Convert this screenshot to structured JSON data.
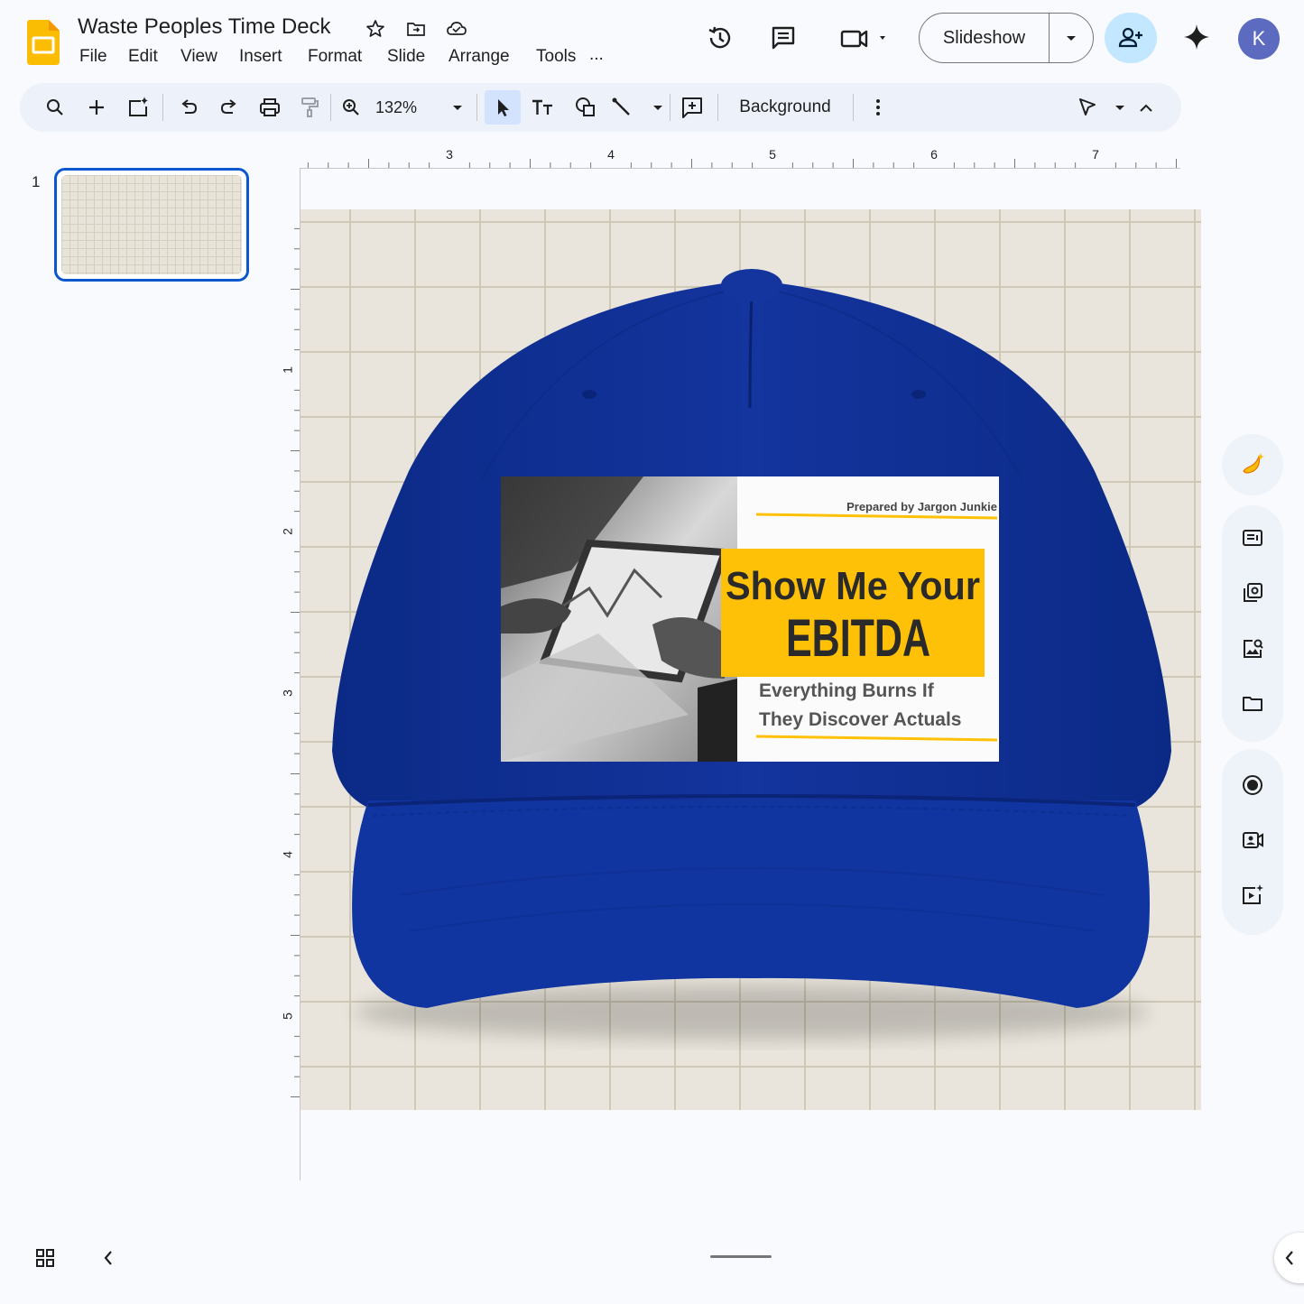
{
  "app": {
    "doc_title": "Waste Peoples Time Deck",
    "menus": [
      "File",
      "Edit",
      "View",
      "Insert",
      "Format",
      "Slide",
      "Arrange",
      "Tools",
      "..."
    ],
    "slideshow_label": "Slideshow",
    "avatar_initial": "K"
  },
  "toolbar": {
    "zoom": "132%",
    "background_label": "Background"
  },
  "filmstrip": {
    "slides": [
      {
        "number": "1"
      }
    ]
  },
  "ruler": {
    "horizontal_labels": [
      "3",
      "4",
      "5",
      "6",
      "7"
    ],
    "vertical_labels": [
      "1",
      "2",
      "3",
      "4",
      "5"
    ]
  },
  "slide": {
    "patch": {
      "prepared_by": "Prepared by Jargon Junkie",
      "headline_line1": "Show Me Your",
      "headline_line2": "EBITDA",
      "subline1": "Everything Burns If",
      "subline2": "They Discover Actuals"
    },
    "colors": {
      "cap": "#10309a",
      "highlight": "#ffc107",
      "canvas": "#e9e5dc",
      "accent": "#0b57d0"
    }
  },
  "icons": {
    "header": [
      "star-icon",
      "move-to-folder-icon",
      "cloud-saved-icon",
      "history-icon",
      "comments-icon",
      "meet-icon",
      "share-icon",
      "gemini-icon"
    ],
    "toolbar": [
      "search-icon",
      "new-slide-icon",
      "ai-slide-icon",
      "undo-icon",
      "redo-icon",
      "print-icon",
      "paint-format-icon",
      "zoom-icon",
      "select-icon",
      "text-box-icon",
      "shape-icon",
      "line-icon",
      "comment-add-icon",
      "more-icon",
      "pointer-mode-icon",
      "collapse-toolbar-icon"
    ],
    "side_panel": [
      "banana-ai-icon",
      "slides-panel-icon",
      "layouts-icon",
      "image-search-icon",
      "folder-icon",
      "record-icon",
      "camera-icon",
      "video-add-icon"
    ]
  }
}
